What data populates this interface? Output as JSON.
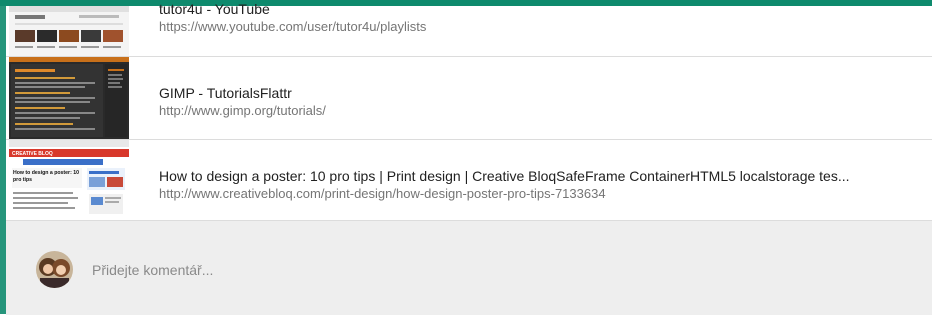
{
  "links": [
    {
      "title": "tutor4u - YouTube",
      "url": "https://www.youtube.com/user/tutor4u/playlists"
    },
    {
      "title": "GIMP - TutorialsFlattr",
      "url": "http://www.gimp.org/tutorials/"
    },
    {
      "title": "How to design a poster: 10 pro tips | Print design | Creative BloqSafeFrame ContainerHTML5 localstorage tes...",
      "url": "http://www.creativebloq.com/print-design/how-design-poster-pro-tips-7133634"
    }
  ],
  "thumbnails": {
    "poster": {
      "brand": "CREATIVE BLOQ",
      "headline": "How to design a poster: 10 pro tips"
    }
  },
  "comment": {
    "placeholder": "Přidejte komentář...",
    "value": ""
  },
  "colors": {
    "accent": "#0e8a6d",
    "comment_bg": "#eeeeee",
    "divider": "#dcdcdc"
  }
}
